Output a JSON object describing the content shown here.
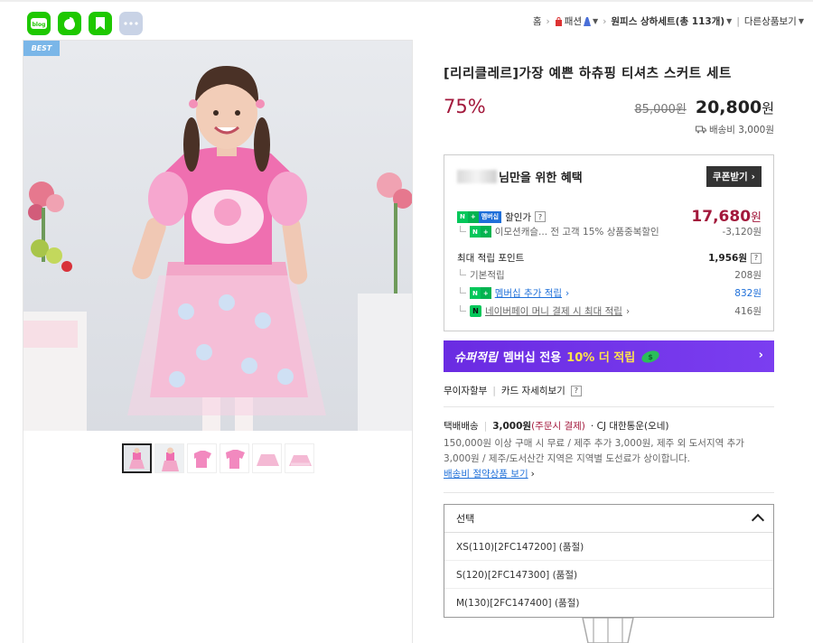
{
  "share": {
    "items": [
      "blog-icon",
      "cafe-icon",
      "keep-icon",
      "more-icon"
    ]
  },
  "breadcrumb": {
    "home": "홈",
    "fashion": "패션",
    "category": "원피스 상하세트(총 113개)",
    "more": "다른상품보기"
  },
  "gallery": {
    "badge": "BEST",
    "thumb_count": 6
  },
  "product": {
    "title": "[리리클레르]가장 예쁜 하츄핑 티셔츠 스커트 세트",
    "discount": "75%",
    "original_price": "85,000원",
    "price": "20,800",
    "price_unit": "원",
    "shipping_fee": "배송비 3,000원"
  },
  "benefit": {
    "heading": "님만을 위한 혜택",
    "coupon_button": "쿠폰받기",
    "discount_label": "할인가",
    "discount_price": "17,680",
    "discount_unit": "원",
    "sub_discount_label": "이모션캐슬... 전 고객 15% 상품중복할인",
    "sub_discount_value": "-3,120원",
    "points_label": "최대 적립 포인트",
    "points_value": "1,956원",
    "basic_label": "기본적립",
    "basic_value": "208원",
    "member_label": "멤버십 추가 적립",
    "member_value": "832원",
    "npay_label": "네이버페이 머니 결제 시 최대 적립",
    "npay_value": "416원",
    "n_badge": "N",
    "plus_badge": "+",
    "membership_badge": "멤버십"
  },
  "super_banner": {
    "part1": "슈퍼적립",
    "part2": "멤버십 전용",
    "part3": "10% 더 적립"
  },
  "installment": {
    "left": "무이자할부",
    "right": "카드 자세히보기"
  },
  "delivery": {
    "type": "택배배송",
    "fee": "3,000원",
    "fee_note": "(주문시 결제)",
    "carrier": "· CJ 대한통운(오네)",
    "desc": "150,000원 이상 구매 시 무료 / 제주 추가 3,000원, 제주 외 도서지역 추가 3,000원 / 제주/도서산간 지역은 지역별 도선료가 상이합니다.",
    "link": "배송비 절약상품 보기"
  },
  "options": {
    "placeholder": "선택",
    "items": [
      "XS(110)[2FC147200] (품절)",
      "S(120)[2FC147300] (품절)",
      "M(130)[2FC147400] (품절)"
    ]
  },
  "colors": {
    "accent_red": "#a3193c",
    "naver_green": "#03c75a",
    "banner_purple": "#6a2be2",
    "link_blue": "#1e6fd9"
  }
}
